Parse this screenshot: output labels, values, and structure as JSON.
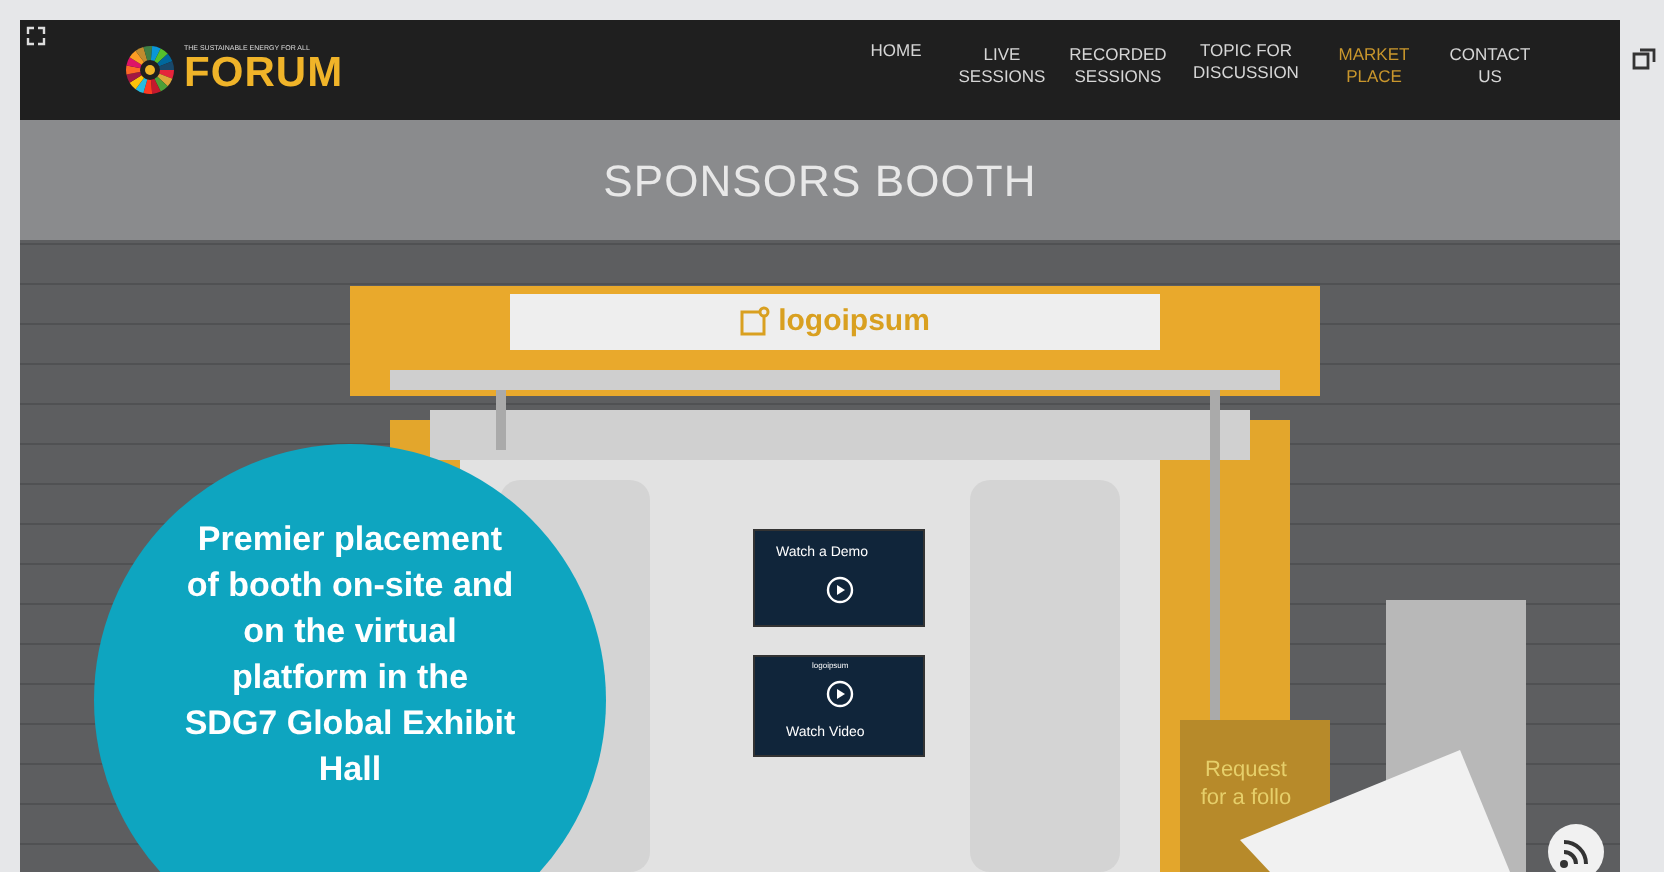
{
  "logo": {
    "tagline": "THE SUSTAINABLE ENERGY FOR ALL",
    "name": "FORUM"
  },
  "nav": [
    {
      "label": "HOME",
      "selected": false
    },
    {
      "label": "LIVE SESSIONS",
      "selected": false
    },
    {
      "label": "RECORDED SESSIONS",
      "selected": false
    },
    {
      "label": "TOPIC FOR DISCUSSION",
      "selected": false
    },
    {
      "label": "MARKET PLACE",
      "selected": true
    },
    {
      "label": "CONTACT US",
      "selected": false
    }
  ],
  "page_title": "SPONSORS BOOTH",
  "booth": {
    "sign": "logoipsum",
    "screen_1": "Watch a Demo",
    "screen_2_logo": "logoipsum",
    "screen_2": "Watch Video",
    "stand": "Request for a follo"
  },
  "badge": "Premier placement of booth on-site and on the virtual platform in the SDG7 Global Exhibit Hall"
}
